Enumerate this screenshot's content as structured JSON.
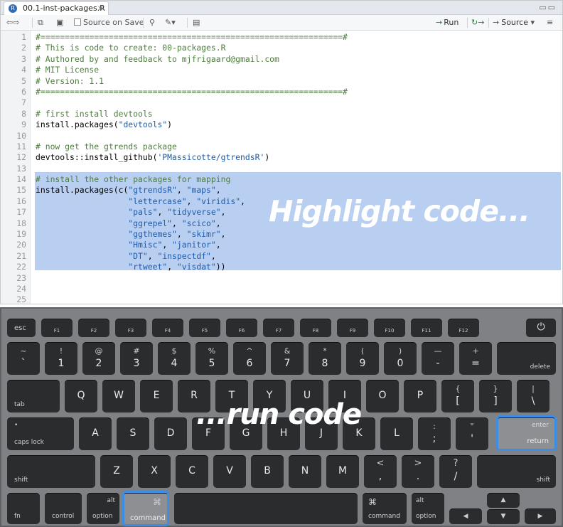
{
  "editor": {
    "tab_title": "00.1-inst-packages.R",
    "toolbar": {
      "source_on_save": "Source on Save",
      "run": "Run",
      "source": "Source"
    },
    "lines": [
      {
        "n": "1",
        "text": "#==============================================================#",
        "kind": "cm"
      },
      {
        "n": "2",
        "text": "# This is code to create: 00-packages.R",
        "kind": "cm"
      },
      {
        "n": "3",
        "text": "# Authored by and feedback to mjfrigaard@gmail.com",
        "kind": "cm"
      },
      {
        "n": "4",
        "text": "# MIT License",
        "kind": "cm"
      },
      {
        "n": "5",
        "text": "# Version: 1.1",
        "kind": "cm"
      },
      {
        "n": "6",
        "text": "#==============================================================#",
        "kind": "cm"
      },
      {
        "n": "7",
        "text": "",
        "kind": ""
      },
      {
        "n": "8",
        "text": "# first install devtools",
        "kind": "cm"
      },
      {
        "n": "9",
        "text": "install.packages(\"devtools\")",
        "kind": ""
      },
      {
        "n": "10",
        "text": "",
        "kind": ""
      },
      {
        "n": "11",
        "text": "# now get the gtrends package",
        "kind": "cm"
      },
      {
        "n": "12",
        "text": "devtools::install_github('PMassicotte/gtrendsR')",
        "kind": ""
      },
      {
        "n": "13",
        "text": "",
        "kind": ""
      },
      {
        "n": "14",
        "text": "# install the other packages for mapping",
        "kind": "cm"
      },
      {
        "n": "15",
        "text": "install.packages(c(\"gtrendsR\", \"maps\",",
        "kind": ""
      },
      {
        "n": "16",
        "text": "                   \"lettercase\", \"viridis\",",
        "kind": ""
      },
      {
        "n": "17",
        "text": "                   \"pals\", \"tidyverse\",",
        "kind": ""
      },
      {
        "n": "18",
        "text": "                   \"ggrepel\", \"scico\",",
        "kind": ""
      },
      {
        "n": "19",
        "text": "                   \"ggthemes\", \"skimr\",",
        "kind": ""
      },
      {
        "n": "20",
        "text": "                   \"Hmisc\", \"janitor\",",
        "kind": ""
      },
      {
        "n": "21",
        "text": "                   \"DT\", \"inspectdf\",",
        "kind": ""
      },
      {
        "n": "22",
        "text": "                   \"rtweet\", \"visdat\"))",
        "kind": ""
      },
      {
        "n": "23",
        "text": "",
        "kind": ""
      },
      {
        "n": "24",
        "text": "",
        "kind": ""
      },
      {
        "n": "25",
        "text": "",
        "kind": ""
      }
    ],
    "overlay_text": "Highlight code..."
  },
  "keyboard": {
    "overlay_text": "...run code",
    "highlight_color": "#3b8ee5",
    "fn_row": [
      "esc",
      "F1",
      "F2",
      "F3",
      "F4",
      "F5",
      "F6",
      "F7",
      "F8",
      "F9",
      "F10",
      "F11",
      "F12"
    ],
    "num_row": [
      [
        "~",
        "`"
      ],
      [
        "!",
        "1"
      ],
      [
        "@",
        "2"
      ],
      [
        "#",
        "3"
      ],
      [
        "$",
        "4"
      ],
      [
        "%",
        "5"
      ],
      [
        "^",
        "6"
      ],
      [
        "&",
        "7"
      ],
      [
        "*",
        "8"
      ],
      [
        "(",
        "9"
      ],
      [
        ")",
        "0"
      ],
      [
        "—",
        "-"
      ],
      [
        "+",
        "="
      ]
    ],
    "num_row_end": "delete",
    "q_row_start": "tab",
    "q_row": [
      "Q",
      "W",
      "E",
      "R",
      "T",
      "Y",
      "U",
      "I",
      "O",
      "P"
    ],
    "q_row_pairs": [
      [
        "{",
        "["
      ],
      [
        "}",
        "]"
      ],
      [
        "|",
        "\\"
      ]
    ],
    "a_row_start": "caps lock",
    "a_row": [
      "A",
      "S",
      "D",
      "F",
      "G",
      "H",
      "J",
      "K",
      "L"
    ],
    "a_row_pairs": [
      [
        ":",
        ";"
      ],
      [
        "\"",
        "'"
      ]
    ],
    "enter_top": "enter",
    "enter_bottom": "return",
    "z_row_start": "shift",
    "z_row": [
      "Z",
      "X",
      "C",
      "V",
      "B",
      "N",
      "M"
    ],
    "z_row_pairs": [
      [
        "<",
        ","
      ],
      [
        ">",
        "."
      ],
      [
        "?",
        "/"
      ]
    ],
    "z_row_end": "shift",
    "bottom_row": {
      "fn": "fn",
      "control": "control",
      "option": "option",
      "command": "command",
      "cmd_symbol": "⌘",
      "alt": "alt"
    },
    "arrows": {
      "left": "◀",
      "right": "▶",
      "up": "▲",
      "down": "▼"
    }
  }
}
